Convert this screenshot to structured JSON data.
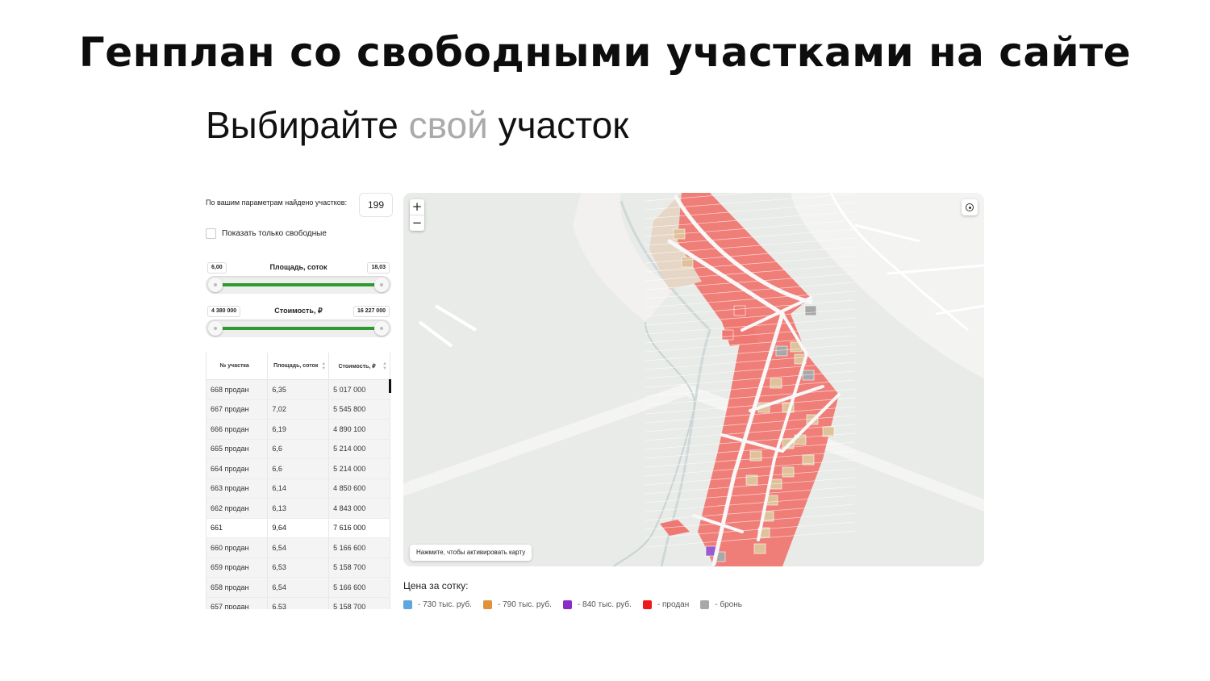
{
  "slide": {
    "title": "Генплан со свободными участками на сайте",
    "subtitle_part1": "Выбирайте",
    "subtitle_part2": "свой",
    "subtitle_part3": "участок"
  },
  "filters": {
    "found_label": "По вашим параметрам найдено участков:",
    "found_count": "199",
    "only_free_label": "Показать только свободные",
    "only_free_checked": false,
    "area": {
      "title": "Площадь, соток",
      "min": "6,00",
      "max": "18,03"
    },
    "price": {
      "title": "Стоимость, ₽",
      "min": "4 380 000",
      "max": "16 227 000"
    }
  },
  "table": {
    "headers": [
      "№ участка",
      "Площадь, соток",
      "Стоимость, ₽"
    ],
    "rows": [
      {
        "num": "668 продан",
        "area": "6,35",
        "price": "5 017 000",
        "free": false
      },
      {
        "num": "667 продан",
        "area": "7,02",
        "price": "5 545 800",
        "free": false
      },
      {
        "num": "666 продан",
        "area": "6,19",
        "price": "4 890 100",
        "free": false
      },
      {
        "num": "665 продан",
        "area": "6,6",
        "price": "5 214 000",
        "free": false
      },
      {
        "num": "664 продан",
        "area": "6,6",
        "price": "5 214 000",
        "free": false
      },
      {
        "num": "663 продан",
        "area": "6,14",
        "price": "4 850 600",
        "free": false
      },
      {
        "num": "662 продан",
        "area": "6,13",
        "price": "4 843 000",
        "free": false
      },
      {
        "num": "661",
        "area": "9,64",
        "price": "7 616 000",
        "free": true
      },
      {
        "num": "660 продан",
        "area": "6,54",
        "price": "5 166 600",
        "free": false
      },
      {
        "num": "659 продан",
        "area": "6,53",
        "price": "5 158 700",
        "free": false
      },
      {
        "num": "658 продан",
        "area": "6,54",
        "price": "5 166 600",
        "free": false
      },
      {
        "num": "657 продан",
        "area": "6,53",
        "price": "5 158 700",
        "free": false
      }
    ]
  },
  "map": {
    "activate_hint": "Нажмите, чтобы активировать карту",
    "zoom_in": "+",
    "zoom_out": "−",
    "plot_colors": {
      "sold": "#f07872",
      "free_790": "#dfc29a",
      "free_840": "#9a5ad0",
      "reserved": "#a8a8a8"
    }
  },
  "legend": {
    "title": "Цена за сотку:",
    "items": [
      {
        "label": "- 730 тыс. руб.",
        "color": "#5ea6e0"
      },
      {
        "label": "- 790 тыс. руб.",
        "color": "#e0913a"
      },
      {
        "label": "- 840 тыс. руб.",
        "color": "#8a2bc8"
      },
      {
        "label": "- продан",
        "color": "#ee1a1a"
      },
      {
        "label": "- бронь",
        "color": "#a8a8a8"
      }
    ]
  }
}
